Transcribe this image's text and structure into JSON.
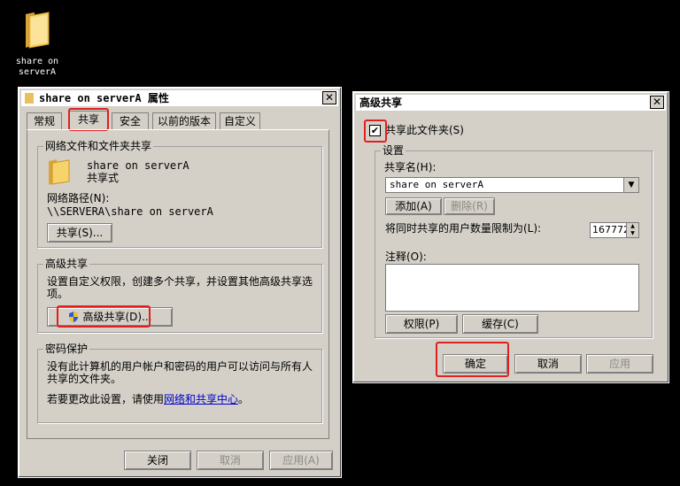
{
  "desktop": {
    "folder_label_line1": "share on",
    "folder_label_line2": "serverA"
  },
  "props_window": {
    "title": "share on serverA 属性",
    "close_glyph": "✕",
    "tabs": [
      "常规",
      "共享",
      "安全",
      "以前的版本",
      "自定义"
    ],
    "share_group": {
      "title": "网络文件和文件夹共享",
      "folder_name": "share on serverA",
      "folder_state": "共享式",
      "path_label": "网络路径(N):",
      "path_value": "\\\\SERVERA\\share on serverA",
      "share_button": "共享(S)..."
    },
    "advanced_group": {
      "title": "高级共享",
      "desc_line1": "设置自定义权限，创建多个共享，并设置其他高级共享选",
      "desc_line2": "项。",
      "advanced_button": "高级共享(D)..."
    },
    "password_group": {
      "title": "密码保护",
      "desc_line1": "没有此计算机的用户帐户和密码的用户可以访问与所有人",
      "desc_line2": "共享的文件夹。",
      "change_prefix": "若要更改此设置，请使用",
      "change_link": "网络和共享中心",
      "change_suffix": "。"
    },
    "buttons": {
      "close": "关闭",
      "cancel": "取消",
      "apply": "应用(A)"
    }
  },
  "adv_window": {
    "title": "高级共享",
    "close_glyph": "✕",
    "share_checkbox": "共享此文件夹(S)",
    "checkbox_glyph": "✔",
    "settings": {
      "title": "设置",
      "share_name_label": "共享名(H):",
      "share_name_value": "share on serverA",
      "add_button": "添加(A)",
      "remove_button": "删除(R)",
      "limit_label": "将同时共享的用户数量限制为(L):",
      "limit_value": "16777216",
      "comment_label": "注释(O):",
      "permissions_button": "权限(P)",
      "cache_button": "缓存(C)"
    },
    "buttons": {
      "ok": "确定",
      "cancel": "取消",
      "apply": "应用"
    }
  },
  "colors": {
    "highlight_box": "#e02020",
    "dialog_bg": "#d4d0c8",
    "link": "#0000cc"
  }
}
